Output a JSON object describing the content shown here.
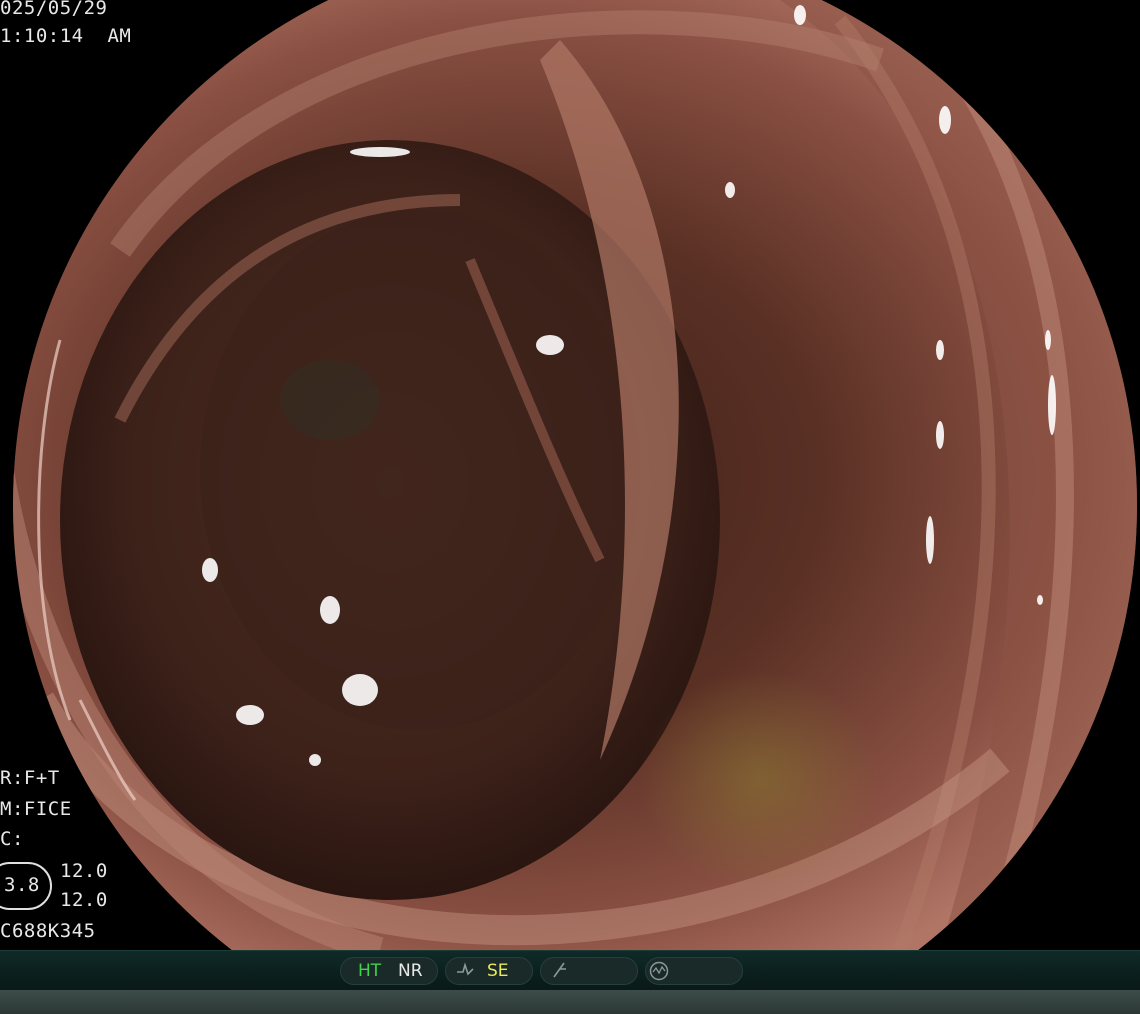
{
  "overlay": {
    "date": "025/05/29",
    "time": "1:10:14  AM",
    "mode_lines": [
      "R:F+T",
      "M:FICE",
      "C:"
    ],
    "magnification": "3.8",
    "values": [
      "12.0",
      "12.0"
    ],
    "scope_model": "C688K345"
  },
  "statusbar": {
    "ht_label": "HT",
    "nr_label": "NR",
    "se_label": "SE",
    "icons": [
      "waveform-icon",
      "slash-icon",
      "circle-wave-icon"
    ]
  },
  "colors": {
    "ht": "#3fd24a",
    "nr": "#e8e8e8",
    "se": "#e8e85a",
    "overlay_text": "#e8e8e8",
    "mucosa": "#7a4436",
    "status_bg": "#0f2a28"
  }
}
